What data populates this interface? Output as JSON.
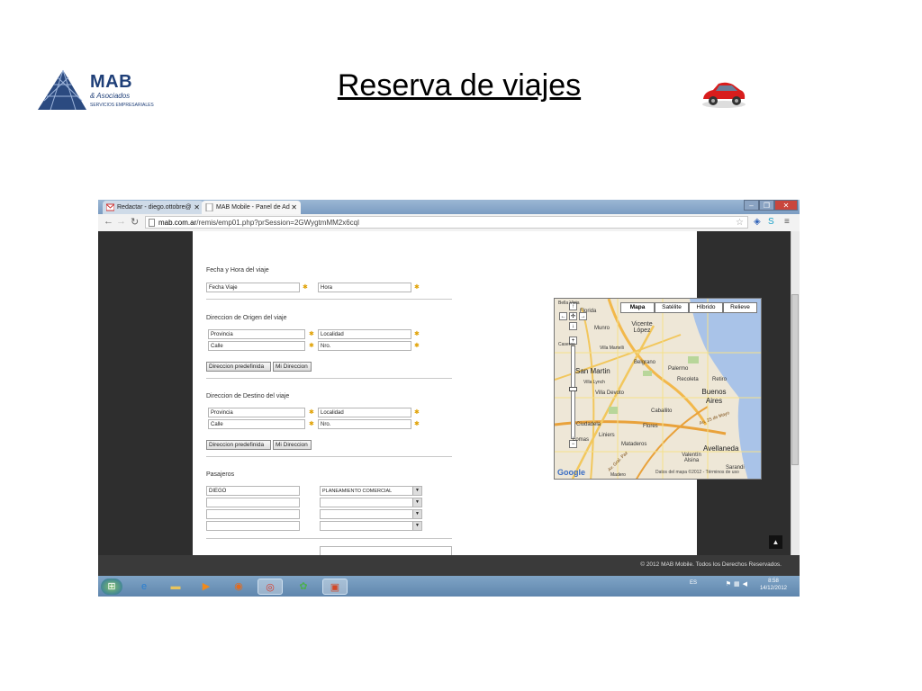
{
  "slide": {
    "title": "Reserva de viajes",
    "logo": {
      "brand": "MAB",
      "sub1": "& Asociados",
      "sub2": "SERVICIOS EMPRESARIALES"
    }
  },
  "browser": {
    "tabs": [
      {
        "label": "Redactar - diego.ottobre@",
        "icon": "gmail-icon"
      },
      {
        "label": "MAB Mobile - Panel de Ad",
        "icon": "page-icon"
      }
    ],
    "url_host": "mab.com.ar",
    "url_path": "/remis/emp01.php?prSession=2GWygtmMM2x6cql"
  },
  "form": {
    "section_fecha": "Fecha y Hora del viaje",
    "fecha_placeholder": "Fecha Viaje",
    "hora_placeholder": "Hora",
    "section_origen": "Direccion de Origen del viaje",
    "section_destino": "Direccion de Destino del viaje",
    "provincia": "Provincia",
    "localidad": "Localidad",
    "calle": "Calle",
    "nro": "Nro.",
    "btn_predef": "Direccion predefinida",
    "btn_mi": "Mi Direccion",
    "section_pasajeros": "Pasajeros",
    "pasajero1": "DIEGO",
    "area1": "PLANEAMIENTO COMERCIAL"
  },
  "map": {
    "types": [
      "Mapa",
      "Satélite",
      "Híbrido",
      "Relieve"
    ],
    "active_type": "Mapa",
    "places": {
      "vicente_lopez": "Vicente López",
      "munro": "Munro",
      "villa_martelli": "Villa Martelli",
      "belgrano": "Belgrano",
      "palermo": "Palermo",
      "san_martin": "San Martin",
      "villa_lynch": "Villa Lynch",
      "recoleta": "Recoleta",
      "retiro": "Retiro",
      "buenos_aires": "Buenos Aires",
      "villa_devoto": "Villa Devoto",
      "caballito": "Caballito",
      "ciudadela": "Ciudadela",
      "flores": "Flores",
      "liniers": "Liniers",
      "mataderos": "Mataderos",
      "avellaneda": "Avellaneda",
      "valentin_alsina": "Valentín Alsina",
      "sarandi": "Sarandi",
      "lomas": "Lomas",
      "madero": "Madero",
      "au25": "Au. 25 de Mayo",
      "gral_paz": "Av. Gral. Paz",
      "caseros_frag": "Caseros",
      "florida_frag": "Florida",
      "bella_vista_frag": "Bella Vista"
    },
    "google": "Google",
    "copyright": "Datos del mapa ©2012 - Términos de uso"
  },
  "footer": {
    "text": "© 2012 MAB Mobile. Todos los Derechos Reservados."
  },
  "taskbar": {
    "lang": "ES",
    "time": "8:58",
    "date": "14/12/2012"
  }
}
